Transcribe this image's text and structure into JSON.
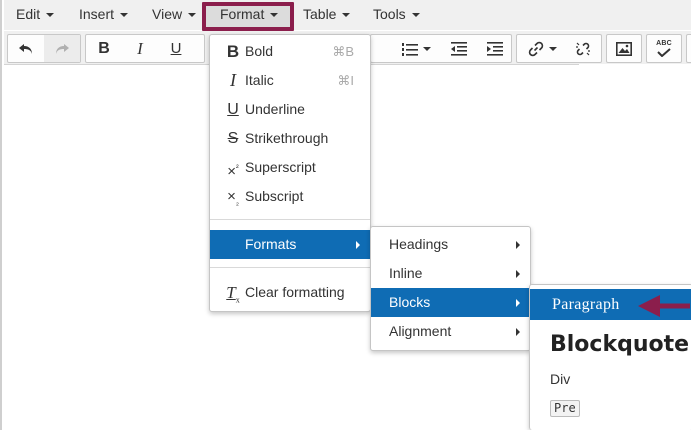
{
  "menubar": {
    "items": [
      {
        "label": "Edit"
      },
      {
        "label": "Insert"
      },
      {
        "label": "View"
      },
      {
        "label": "Format"
      },
      {
        "label": "Table"
      },
      {
        "label": "Tools"
      }
    ]
  },
  "toolbar": {
    "buttons": [
      "undo-icon",
      "redo-icon",
      "bold-icon",
      "italic-icon",
      "underline-icon",
      "numbered-list-icon",
      "outdent-icon",
      "indent-icon",
      "link-icon",
      "unlink-icon",
      "image-icon",
      "spellcheck-icon"
    ],
    "spellcheck_text": "ABC"
  },
  "format_menu": {
    "items": [
      {
        "label": "Bold",
        "shortcut": "⌘B"
      },
      {
        "label": "Italic",
        "shortcut": "⌘I"
      },
      {
        "label": "Underline"
      },
      {
        "label": "Strikethrough"
      },
      {
        "label": "Superscript"
      },
      {
        "label": "Subscript"
      },
      {
        "label": "Formats"
      },
      {
        "label": "Clear formatting"
      }
    ]
  },
  "formats_submenu": {
    "items": [
      {
        "label": "Headings"
      },
      {
        "label": "Inline"
      },
      {
        "label": "Blocks"
      },
      {
        "label": "Alignment"
      }
    ]
  },
  "blocks_submenu": {
    "items": [
      {
        "label": "Paragraph"
      },
      {
        "label": "Blockquote"
      },
      {
        "label": "Div"
      },
      {
        "label": "Pre"
      }
    ]
  },
  "colors": {
    "highlight_frame": "#8b1e4c",
    "active_item": "#0f6cb4",
    "annotation_arrow": "#8b1e4c"
  }
}
